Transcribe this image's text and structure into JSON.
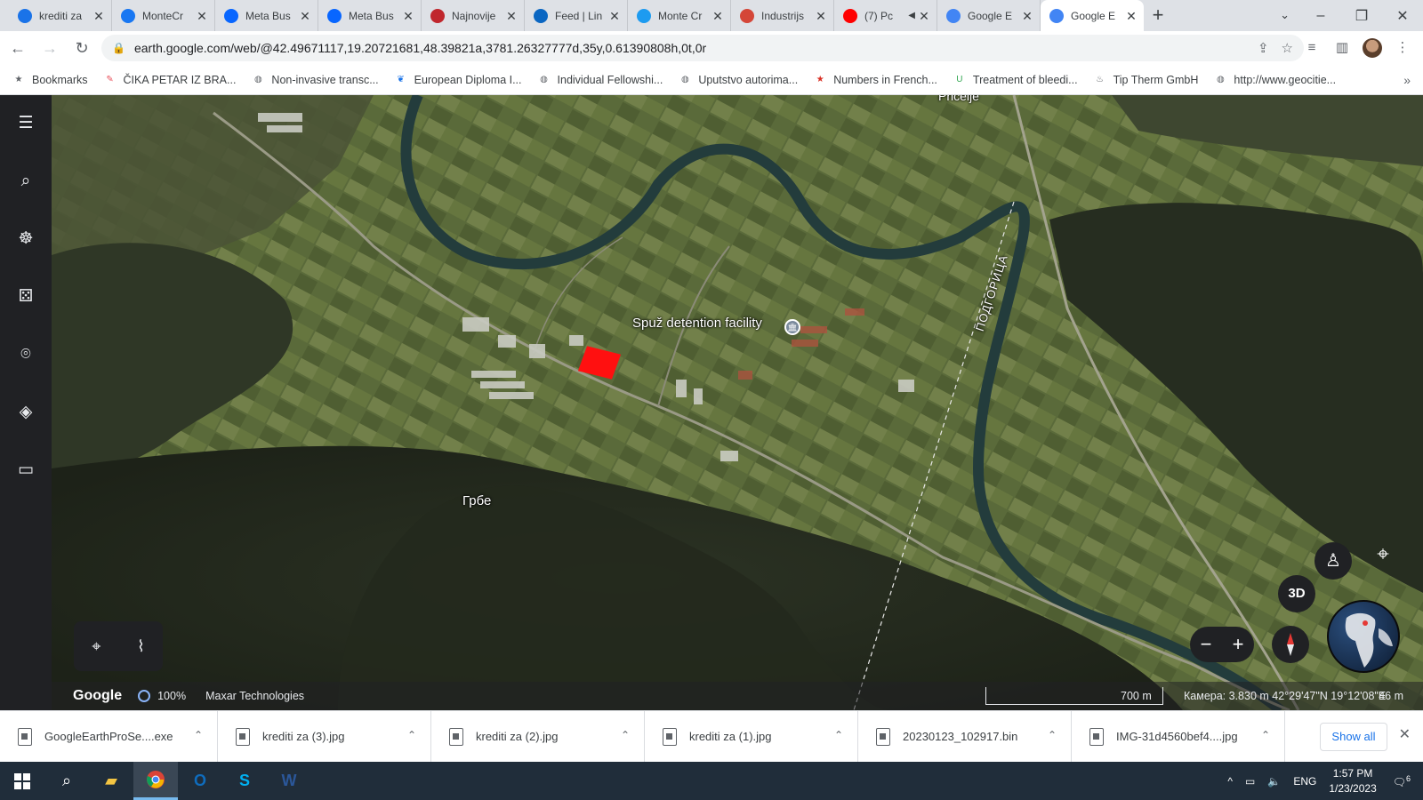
{
  "browser": {
    "tabs": [
      {
        "title": "krediti za",
        "icon": "generic-c-icon",
        "color": "#1a73e8"
      },
      {
        "title": "MonteCr",
        "icon": "facebook-icon",
        "color": "#1877f2"
      },
      {
        "title": "Meta Bus",
        "icon": "meta-icon",
        "color": "#0866ff"
      },
      {
        "title": "Meta Bus",
        "icon": "meta-icon",
        "color": "#0866ff"
      },
      {
        "title": "Najnovije",
        "icon": "news-icon",
        "color": "#c0272d"
      },
      {
        "title": "Feed | Lin",
        "icon": "linkedin-icon",
        "color": "#0a66c2"
      },
      {
        "title": "Monte Cr",
        "icon": "twitter-icon",
        "color": "#1d9bf0"
      },
      {
        "title": "Industrijs",
        "icon": "gear-icon",
        "color": "#d44638"
      },
      {
        "title": "(7) Pc",
        "icon": "youtube-icon",
        "color": "#ff0000"
      },
      {
        "title": "Google E",
        "icon": "google-earth-icon",
        "color": "#4285f4"
      },
      {
        "title": "Google E",
        "icon": "google-earth-icon",
        "color": "#4285f4",
        "active": true
      }
    ],
    "url": "earth.google.com/web/@42.49671117,19.20721681,48.39821a,3781.26327777d,35y,0.61390808h,0t,0r",
    "bookmarks": [
      {
        "label": "Bookmarks",
        "icon": "star-icon"
      },
      {
        "label": "ČIKA PETAR IZ BRA...",
        "icon": "feather-icon"
      },
      {
        "label": "Non-invasive transc...",
        "icon": "globe-icon"
      },
      {
        "label": "European Diploma I...",
        "icon": "tree-icon"
      },
      {
        "label": "Individual Fellowshi...",
        "icon": "globe-icon"
      },
      {
        "label": "Uputstvo autorima...",
        "icon": "globe-icon"
      },
      {
        "label": "Numbers in French...",
        "icon": "star-flag-icon"
      },
      {
        "label": "Treatment of bleedi...",
        "icon": "u-icon"
      },
      {
        "label": "Tip Therm GmbH",
        "icon": "flame-icon"
      },
      {
        "label": "http://www.geocitie...",
        "icon": "globe-icon"
      }
    ]
  },
  "map": {
    "labels": {
      "detention": "Spuž detention facility",
      "village": "Грбе",
      "road": "ПОДГОРИЦА",
      "top": "Pričelje"
    },
    "status": {
      "brand": "Google",
      "loaded": "100%",
      "provider": "Maxar Technologies",
      "scale": "700 m",
      "camera": "Камера: 3.830 m   42°29'47\"N 19°12'08\"E",
      "altitude": "46 m"
    },
    "controls": {
      "btn3d": "3D"
    }
  },
  "downloads": {
    "items": [
      "GoogleEarthProSe....exe",
      "krediti za (3).jpg",
      "krediti za (2).jpg",
      "krediti za (1).jpg",
      "20230123_102917.bin",
      "IMG-31d4560bef4....jpg"
    ],
    "show_all": "Show all"
  },
  "taskbar": {
    "lang": "ENG",
    "time": "1:57 PM",
    "date": "1/23/2023",
    "notif_count": "6"
  }
}
